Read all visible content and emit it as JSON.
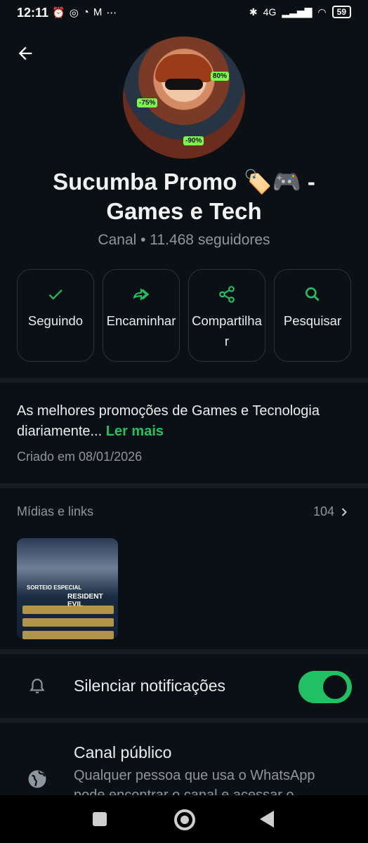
{
  "status_bar": {
    "time": "12:11",
    "left_icons": [
      "alarm-icon",
      "instagram-icon",
      "alarm-icon",
      "gmail-icon",
      "more-dots-icon"
    ],
    "network": "4G",
    "battery": "59"
  },
  "channel": {
    "name_line1": "Sucumba Promo 🏷️🎮  -",
    "name_line2": "Games e Tech",
    "subtitle": "Canal • 11.468 seguidores"
  },
  "actions": [
    {
      "label": "Seguindo",
      "icon": "check-icon"
    },
    {
      "label": "Encaminhar",
      "icon": "forward-icon"
    },
    {
      "label": "Compartilhar",
      "icon": "share-icon"
    },
    {
      "label": "Pesquisar",
      "icon": "search-icon"
    }
  ],
  "description": {
    "text": "As melhores promoções de Games e Tecnologia diariamente...",
    "more": "Ler mais",
    "created": "Criado em 08/01/2026"
  },
  "media": {
    "label": "Mídias e links",
    "count": "104"
  },
  "mute": {
    "label": "Silenciar notificações",
    "enabled": true
  },
  "public_channel": {
    "title": "Canal público",
    "description": "Qualquer pessoa que usa o WhatsApp pode encontrar o canal e acessar o"
  },
  "colors": {
    "accent": "#21c063",
    "background": "#0b1014",
    "muted_text": "#8c979d"
  }
}
